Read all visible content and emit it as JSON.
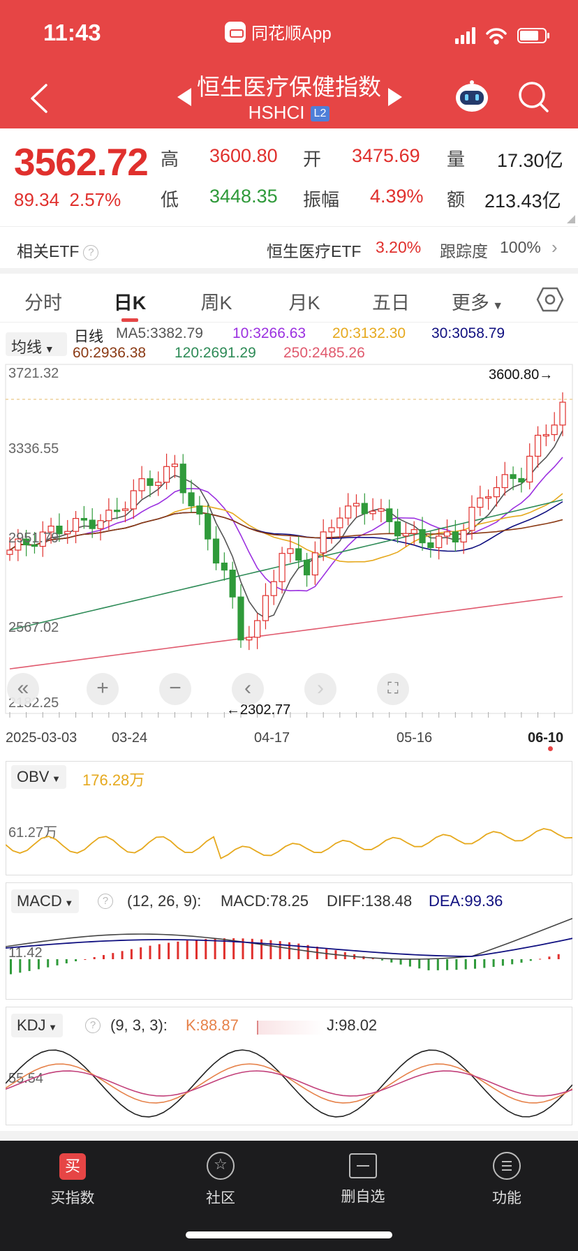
{
  "status": {
    "time": "11:43",
    "app_name": "同花顺App"
  },
  "header": {
    "title": "恒生医疗保健指数",
    "code": "HSHCI",
    "level": "L2"
  },
  "quote": {
    "price": "3562.72",
    "change": "89.34",
    "change_pct": "2.57%",
    "high_label": "高",
    "high": "3600.80",
    "low_label": "低",
    "low": "3448.35",
    "open_label": "开",
    "open": "3475.69",
    "amp_label": "振幅",
    "amplitude": "4.39%",
    "vol_label": "量",
    "volume": "17.30亿",
    "amt_label": "额",
    "amount": "213.43亿"
  },
  "etf": {
    "label": "相关ETF",
    "name": "恒生医疗ETF",
    "pct": "3.20%",
    "track_label": "跟踪度",
    "track": "100%"
  },
  "tabs": [
    {
      "label": "分时"
    },
    {
      "label": "日K"
    },
    {
      "label": "周K"
    },
    {
      "label": "月K"
    },
    {
      "label": "五日"
    },
    {
      "label": "更多"
    }
  ],
  "ma_legend": {
    "selector": "均线",
    "period": "日线",
    "ma5": "MA5:3382.79",
    "ma10": "10:3266.63",
    "ma20": "20:3132.30",
    "ma30": "30:3058.79",
    "ma60": "60:2936.38",
    "ma120": "120:2691.29",
    "ma250": "250:2485.26"
  },
  "kline_axis": {
    "y_labels": [
      "3721.32",
      "3336.55",
      "2951.79",
      "2567.02",
      "2182.25"
    ],
    "x_labels": [
      "2025-03-03",
      "03-24",
      "04-17",
      "05-16",
      "06-10"
    ],
    "high_marker": "3600.80→",
    "low_marker": "←2302.77"
  },
  "obv": {
    "name": "OBV",
    "value": "176.28万",
    "axis_label": "61.27万"
  },
  "macd": {
    "name": "MACD",
    "params": "(12, 26, 9):",
    "macd": "MACD:78.25",
    "diff": "DIFF:138.48",
    "dea": "DEA:99.36",
    "axis_label": "11.42"
  },
  "kdj": {
    "name": "KDJ",
    "params": "(9, 3, 3):",
    "k": "K:88.87",
    "j": "J:98.02",
    "axis_label": "55.54"
  },
  "nav": [
    {
      "label": "买指数",
      "icon": "buy-icon"
    },
    {
      "label": "社区",
      "icon": "community-icon"
    },
    {
      "label": "删自选",
      "icon": "remove-watchlist-icon"
    },
    {
      "label": "功能",
      "icon": "menu-icon"
    }
  ],
  "colors": {
    "brand": "#e64545",
    "up": "#e0302d",
    "down": "#2f9a3a",
    "ma5": "#555555",
    "ma10": "#9b30e0",
    "ma20": "#e6a91e",
    "ma30": "#101080",
    "ma60": "#8b3a14",
    "ma120": "#2e8b57",
    "ma250": "#e05a6e"
  }
}
